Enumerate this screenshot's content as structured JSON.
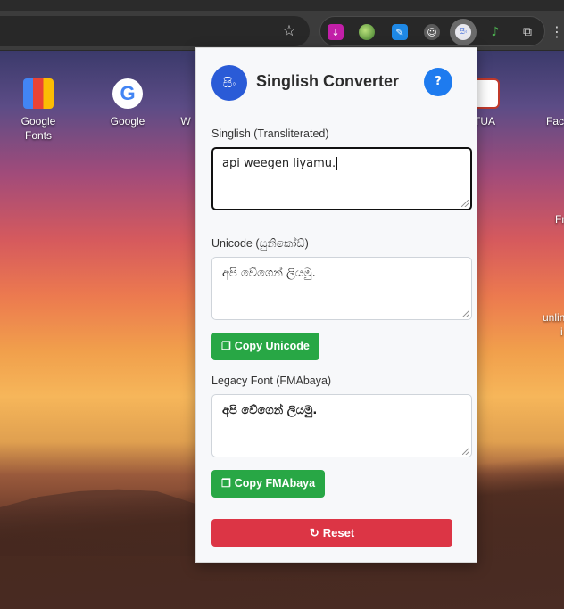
{
  "browser": {
    "extensions": [
      {
        "name": "download-extension-icon"
      },
      {
        "name": "globe-extension-icon"
      },
      {
        "name": "pen-extension-icon"
      },
      {
        "name": "robot-extension-icon"
      },
      {
        "name": "singlish-converter-extension-icon",
        "glyph": "සිං"
      },
      {
        "name": "music-note-extension-icon"
      },
      {
        "name": "puzzle-extensions-icon"
      }
    ],
    "star_glyph": "☆",
    "menu_glyph": "⋮"
  },
  "desktop": {
    "icons": [
      {
        "label": "Google\nFonts"
      },
      {
        "label": "Google"
      },
      {
        "label": "W"
      },
      {
        "label": "TUA"
      },
      {
        "label": "Fac"
      },
      {
        "label": "Fr"
      },
      {
        "label": "unlin"
      },
      {
        "label": "i"
      }
    ]
  },
  "popup": {
    "logo_text": "සිං",
    "title": "Singlish Converter",
    "help_label": "?",
    "singlish": {
      "label": "Singlish (Transliterated)",
      "value": "api  weegen liyamu."
    },
    "unicode": {
      "label": "Unicode (යුනිකෝඩ්)",
      "value": "අපි  වේගෙන් ලියමු.",
      "copy_label": "Copy Unicode"
    },
    "legacy": {
      "label": "Legacy Font (FMAbaya)",
      "value": "අපි  වේගෙන් ලියමු.",
      "copy_label": "Copy FMAbaya"
    },
    "reset_label": "Reset",
    "colors": {
      "primary_blue": "#1e7bef",
      "copy_green": "#28a745",
      "reset_red": "#dc3545"
    }
  }
}
